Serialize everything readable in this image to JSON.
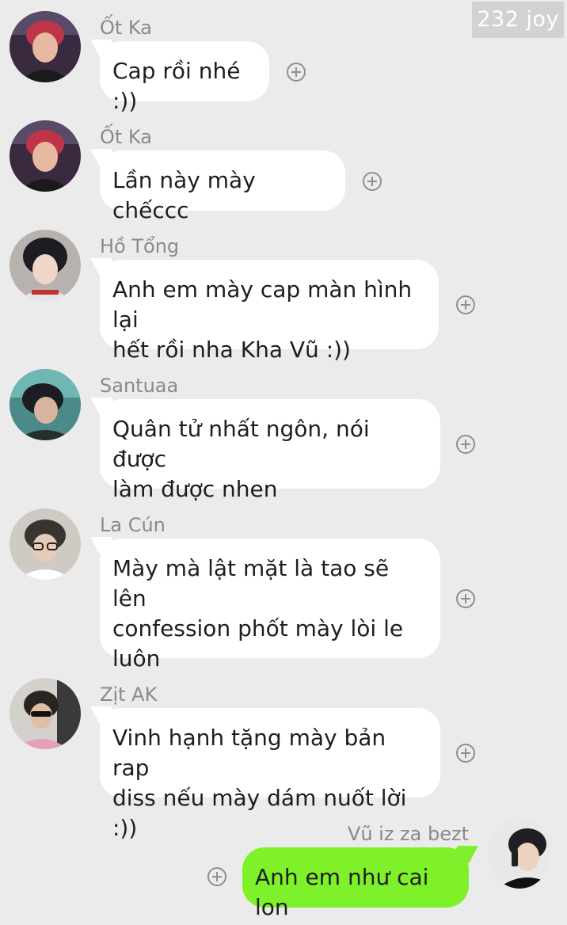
{
  "watermark": "232 joy",
  "messages": [
    {
      "sender": "Ốt Ka",
      "text": "Cap rồi nhé :))",
      "avatar_icon": "avatar-red-hair-icon"
    },
    {
      "sender": "Ốt Ka",
      "text": "Lần này mày chếccc",
      "avatar_icon": "avatar-red-hair-icon"
    },
    {
      "sender": "Hồ Tổng",
      "text": "Anh em mày cap màn hình lại\nhết rồi nha Kha Vũ :))",
      "avatar_icon": "avatar-dark-hair-icon"
    },
    {
      "sender": "Santuaa",
      "text": "Quân tử nhất ngôn, nói được\nlàm được nhen",
      "avatar_icon": "avatar-teal-icon"
    },
    {
      "sender": "La Cún",
      "text": "Mày mà lật mặt là tao sẽ lên\nconfession phốt mày lòi le\nluôn",
      "avatar_icon": "avatar-glasses-icon"
    },
    {
      "sender": "Zịt AK",
      "text": "Vinh hạnh tặng mày bản rap\ndiss nếu mày dám nuốt lời :))",
      "avatar_icon": "avatar-sunglasses-icon"
    }
  ],
  "own_message": {
    "sender": "Vũ iz za bezt",
    "text": "Anh em như cai lon",
    "avatar_icon": "avatar-phone-icon"
  },
  "colors": {
    "background": "#ebebeb",
    "incoming_bubble": "#ffffff",
    "outgoing_bubble": "#7ef12a",
    "sender_name": "#8a8a8a"
  }
}
